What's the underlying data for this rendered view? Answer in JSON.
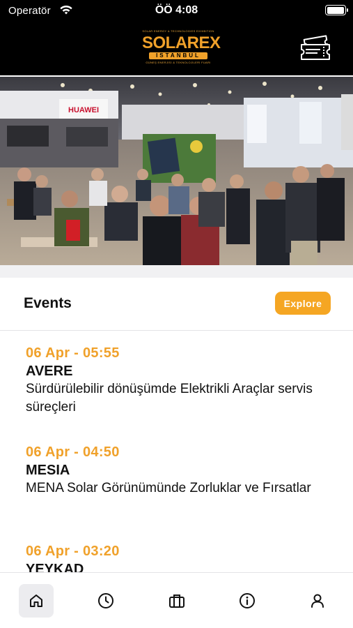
{
  "status_bar": {
    "carrier": "Operatör",
    "time": "ÖÖ 4:08",
    "battery_level": 1.0
  },
  "header": {
    "logo": {
      "tagline_top": "SOLAR ENERGY & TECHNOLOGIES EXHIBITION",
      "wordmark": "SOLAREX",
      "city": "ISTANBUL",
      "tagline_bottom": "GÜNEŞ ENERJİSİ & TEKNOLOJİLERİ FUARI"
    },
    "right_icon": "ticket-icon"
  },
  "banner": {
    "sign_text": "HUAWEI"
  },
  "events": {
    "title": "Events",
    "explore_label": "Explore",
    "items": [
      {
        "time": "06 Apr - 05:55",
        "organizer": "AVERE",
        "title": "Sürdürülebilir dönüşümde Elektrikli Araçlar servis süreçleri"
      },
      {
        "time": "06 Apr - 04:50",
        "organizer": "MESIA",
        "title": "MENA Solar Görünümünde Zorluklar ve Fırsatlar"
      },
      {
        "time": "06 Apr - 03:20",
        "organizer": "YEYKAD",
        "title": ""
      }
    ]
  },
  "tabbar": {
    "tabs": [
      {
        "icon": "home-icon",
        "active": true
      },
      {
        "icon": "clock-icon",
        "active": false
      },
      {
        "icon": "briefcase-icon",
        "active": false
      },
      {
        "icon": "info-icon",
        "active": false
      },
      {
        "icon": "user-icon",
        "active": false
      }
    ]
  },
  "colors": {
    "accent": "#f0a12a",
    "header_bg": "#000000",
    "explore_bg": "#f5a623"
  }
}
